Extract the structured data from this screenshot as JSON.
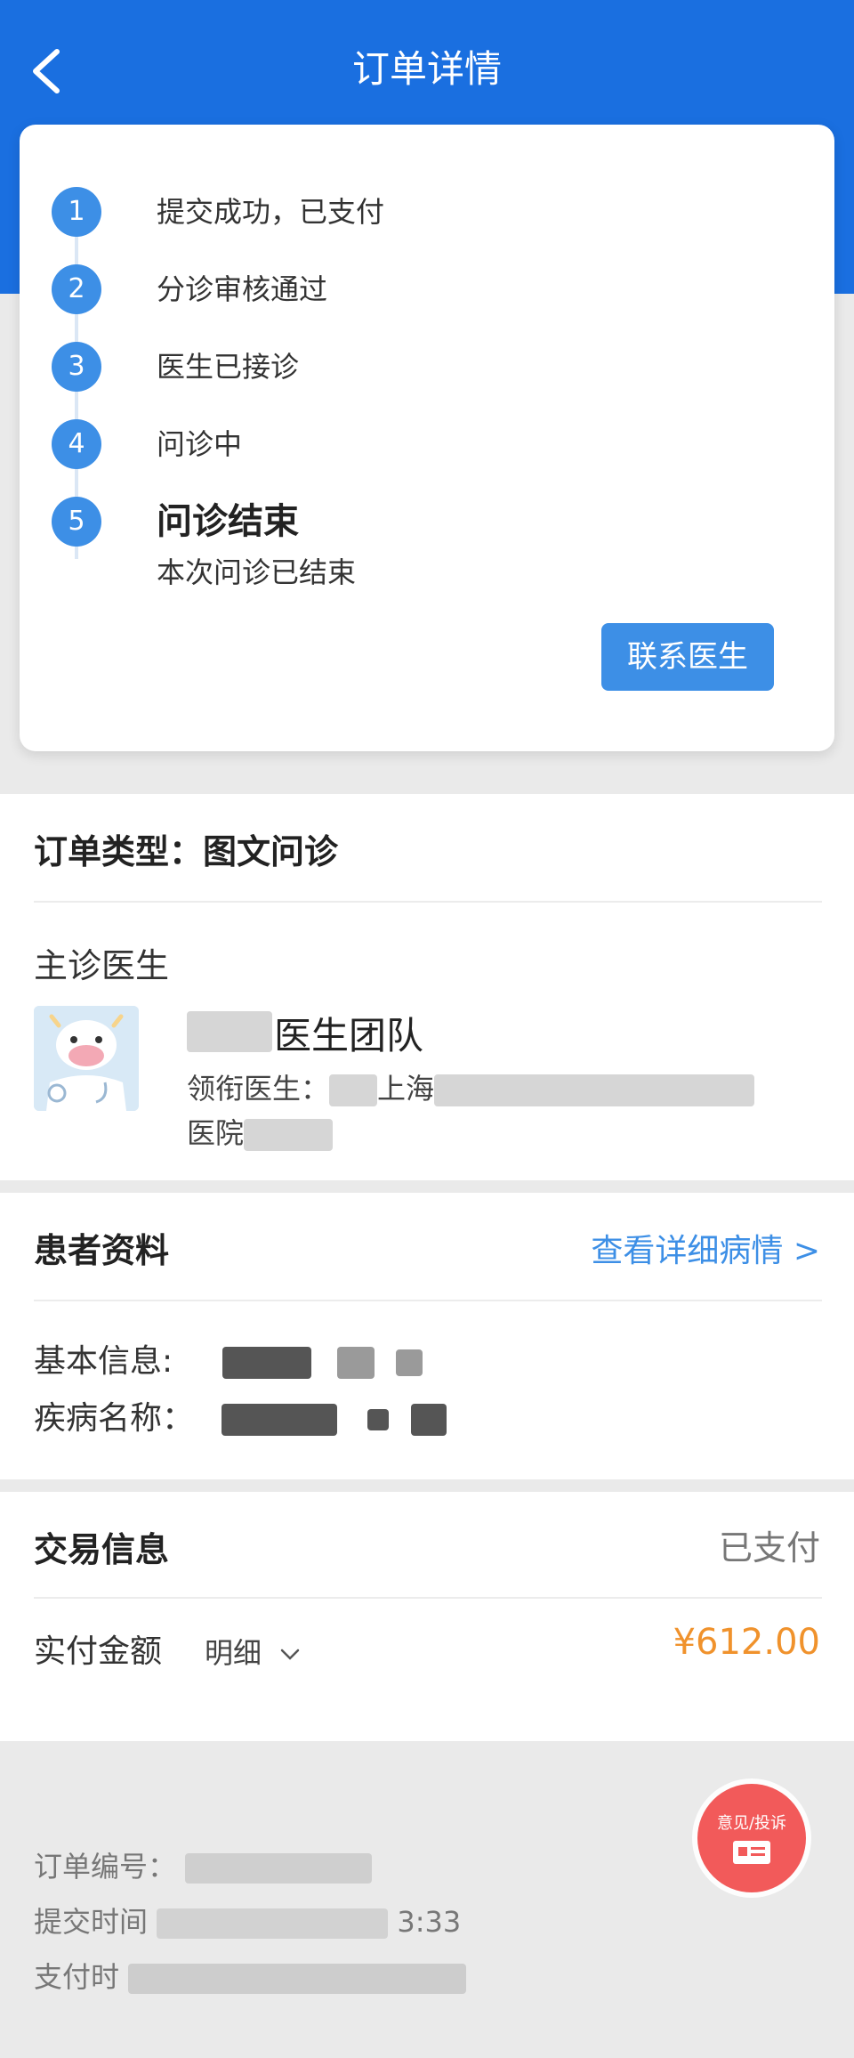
{
  "header": {
    "title": "订单详情"
  },
  "progress": {
    "steps": [
      {
        "num": "1",
        "label": "提交成功，已支付"
      },
      {
        "num": "2",
        "label": "分诊审核通过"
      },
      {
        "num": "3",
        "label": "医生已接诊"
      },
      {
        "num": "4",
        "label": "问诊中"
      },
      {
        "num": "5",
        "label": "问诊结束"
      }
    ],
    "final_desc": "本次问诊已结束",
    "contact_button": "联系医生"
  },
  "order": {
    "type_label": "订单类型：图文问诊",
    "doctor_section_label": "主诊医生",
    "team_name": "医生团队",
    "lead_doctor_label": "领衔医生：",
    "hospital_city": "上海",
    "hospital_suffix": "医院"
  },
  "patient": {
    "title": "患者资料",
    "view_detail": "查看详细病情 >",
    "basic_info_label": "基本信息:",
    "disease_label": "疾病名称："
  },
  "trade": {
    "title": "交易信息",
    "status": "已支付",
    "paid_label": "实付金额",
    "detail_toggle": "明细",
    "amount": "¥612.00"
  },
  "footer": {
    "order_no_label": "订单编号：",
    "submit_time_label": "提交时间",
    "submit_time_tail": "3:33",
    "pay_time_label": "支付时"
  },
  "feedback": {
    "label": "意见/投诉"
  },
  "colors": {
    "header_blue": "#1a6fe0",
    "step_blue": "#3d8fe6",
    "price_orange": "#f0922c",
    "feedback_red": "#f25a5a"
  },
  "icons": [
    "back-arrow-icon",
    "chevron-down-icon",
    "doctor-avatar-icon",
    "feedback-icon"
  ]
}
